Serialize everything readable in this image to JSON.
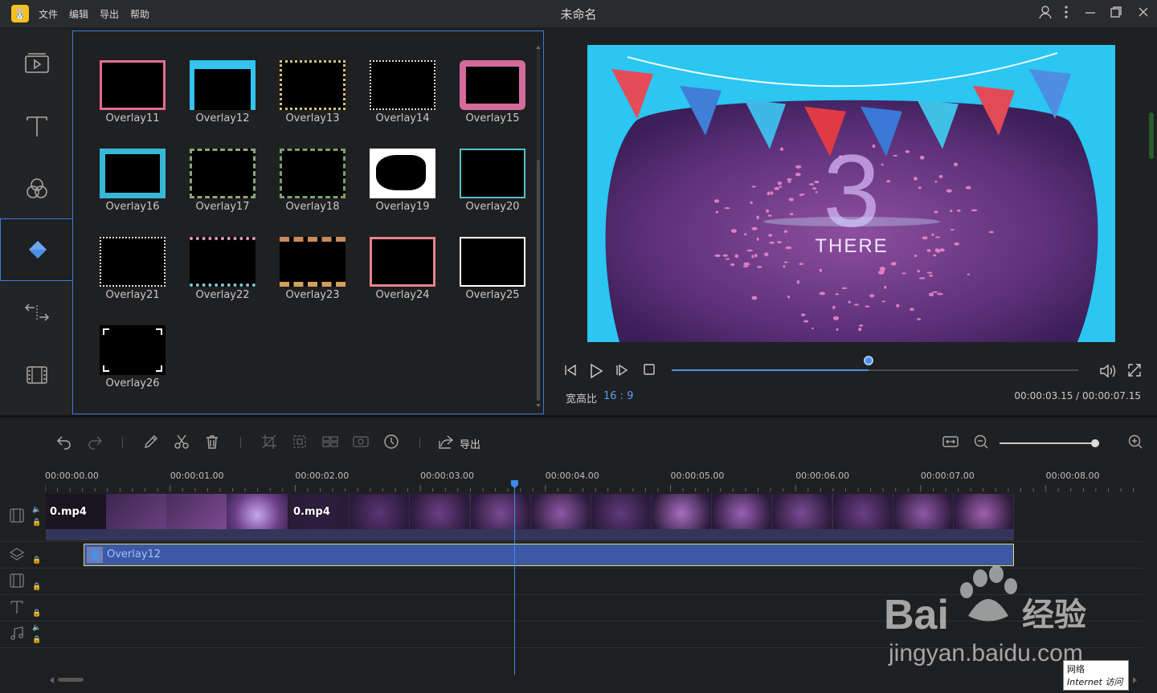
{
  "titlebar": {
    "logo_glyph": "🐰",
    "menus": [
      "文件",
      "编辑",
      "导出",
      "帮助"
    ],
    "title": "未命名",
    "icons": [
      "user-icon",
      "more-icon",
      "minimize-icon",
      "restore-icon",
      "close-icon"
    ]
  },
  "rail": {
    "items": [
      {
        "name": "media",
        "icon": "media-play-icon"
      },
      {
        "name": "text",
        "icon": "text-icon"
      },
      {
        "name": "filters",
        "icon": "filters-icon"
      },
      {
        "name": "overlays",
        "icon": "overlay-icon",
        "active": true
      },
      {
        "name": "transitions",
        "icon": "transition-icon"
      },
      {
        "name": "elements",
        "icon": "film-icon"
      }
    ]
  },
  "overlays": [
    {
      "label": "Overlay11",
      "style": "pink-border"
    },
    {
      "label": "Overlay12",
      "style": "bunting"
    },
    {
      "label": "Overlay13",
      "style": "gold-dots"
    },
    {
      "label": "Overlay14",
      "style": "white-dots"
    },
    {
      "label": "Overlay15",
      "style": "pink-frame"
    },
    {
      "label": "Overlay16",
      "style": "blue-swirl"
    },
    {
      "label": "Overlay17",
      "style": "vine"
    },
    {
      "label": "Overlay18",
      "style": "vine-green"
    },
    {
      "label": "Overlay19",
      "style": "white-blob"
    },
    {
      "label": "Overlay20",
      "style": "teal-corners"
    },
    {
      "label": "Overlay21",
      "style": "white-hearts"
    },
    {
      "label": "Overlay22",
      "style": "flowers"
    },
    {
      "label": "Overlay23",
      "style": "triangles"
    },
    {
      "label": "Overlay24",
      "style": "pink-roses"
    },
    {
      "label": "Overlay25",
      "style": "camera-frame"
    },
    {
      "label": "Overlay26",
      "style": "camera-corners"
    }
  ],
  "preview": {
    "big_number": "3",
    "caption": "THERE",
    "aspect_label": "宽高比",
    "aspect_value": "16 : 9",
    "current_time": "00:00:03.15",
    "total_time": "00:00:07.15",
    "timecode": "00:00:03.15 / 00:00:07.15",
    "progress": 0.485
  },
  "toolbar": {
    "export_label": "导出",
    "zoom_level": 0.92
  },
  "ruler": {
    "labels": [
      "00:00:00.00",
      "00:00:01.00",
      "00:00:02.00",
      "00:00:03.00",
      "00:00:04.00",
      "00:00:05.00",
      "00:00:06.00",
      "00:00:07.00",
      "00:00:08.00"
    ]
  },
  "tracks": {
    "video_clips": [
      {
        "label": "0.mp4"
      },
      {
        "label": "0.mp4"
      }
    ],
    "overlay_clip": {
      "label": "Overlay12"
    }
  },
  "watermark": {
    "brand": "Bai",
    "brand_cn": "经验",
    "url": "jingyan.baidu.com"
  },
  "tooltip": {
    "line1": "网络",
    "line2": "Internet 访问"
  }
}
